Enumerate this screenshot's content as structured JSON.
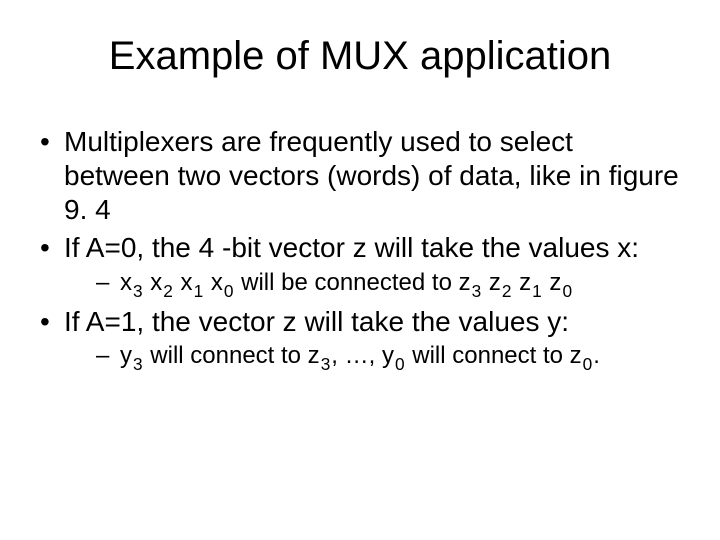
{
  "title": "Example of MUX application",
  "b1": "Multiplexers are frequently used to select between two vectors (words) of data, like in figure 9. 4",
  "b2": "If A=0, the 4 -bit vector z will take the values x:",
  "b2s_a": "x",
  "b2s_b": " x",
  "b2s_c": " x",
  "b2s_d": " x",
  "b2s_e": " will be connected to z",
  "b2s_f": " z",
  "b2s_g": " z",
  "b2s_h": " z",
  "s3": "3",
  "s2": "2",
  "s1": "1",
  "s0": "0",
  "b3": "If A=1, the vector z will take the values y:",
  "b3s_a": "y",
  "b3s_b": " will connect to z",
  "b3s_c": ", …, y",
  "b3s_d": " will connect to z",
  "b3s_e": "."
}
